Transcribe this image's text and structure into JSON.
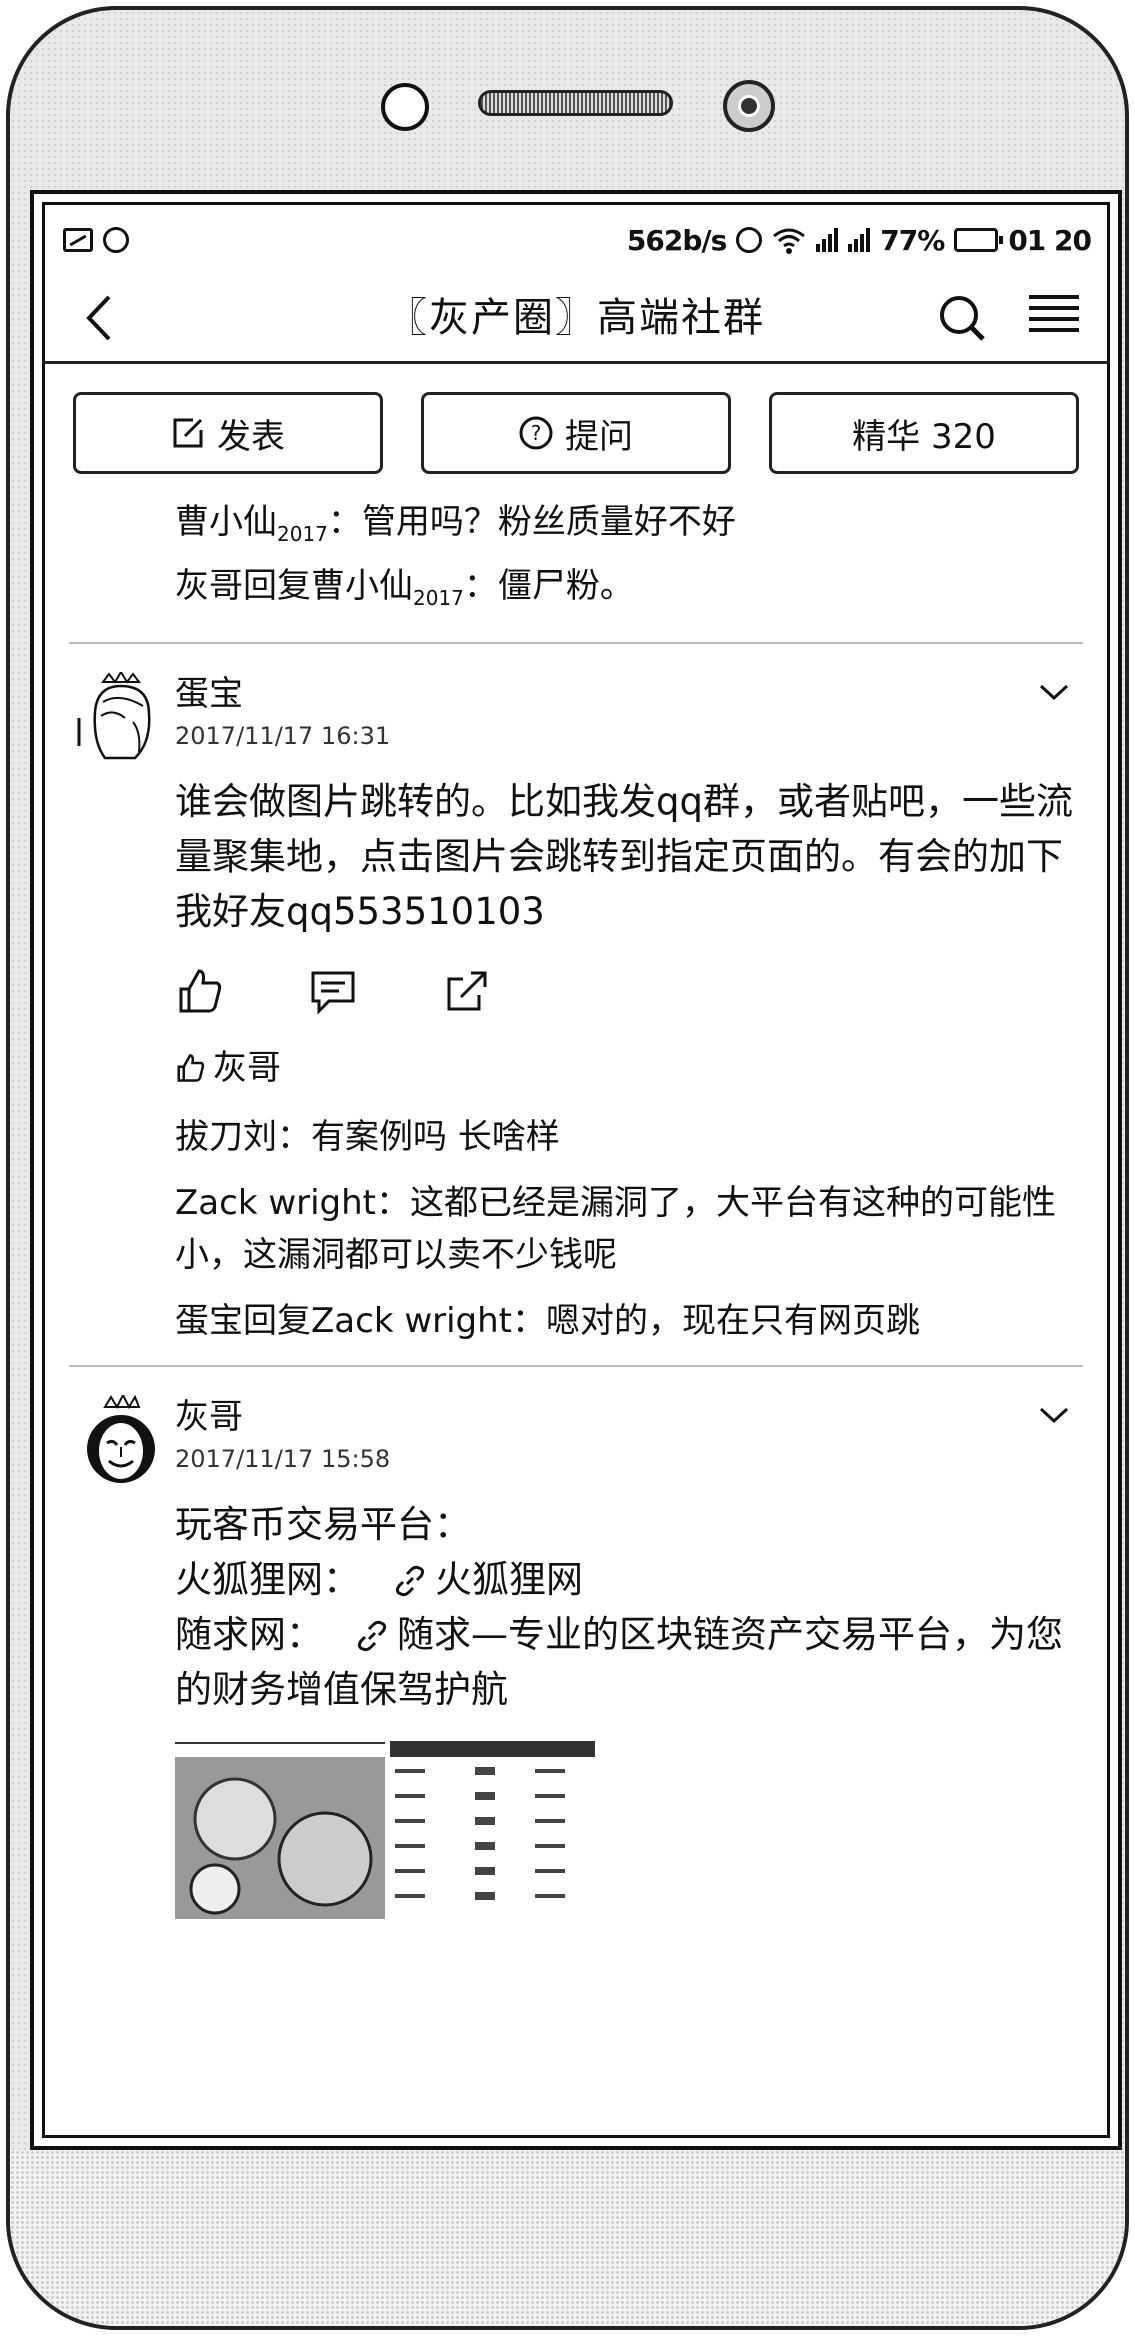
{
  "status_bar": {
    "speed": "562b/s",
    "battery": "77%",
    "time": "01 20"
  },
  "nav": {
    "title": "〖灰产圈〗高端社群"
  },
  "actions": {
    "post": "发表",
    "ask": "提问",
    "featured": "精华 320"
  },
  "top_comments": [
    {
      "author": "曹小仙",
      "author_sub": "2017",
      "text": "：管用吗？粉丝质量好不好"
    },
    {
      "author": "灰哥回复曹小仙",
      "author_sub": "2017",
      "text": "：僵尸粉。"
    }
  ],
  "post1": {
    "name": "蛋宝",
    "time": "2017/11/17 16:31",
    "body": "谁会做图片跳转的。比如我发qq群，或者贴吧，一些流量聚集地，点击图片会跳转到指定页面的。有会的加下我好友qq553510103",
    "liked_by": "灰哥",
    "comments": [
      "拔刀刘：有案例吗  长啥样",
      "Zack  wright：这都已经是漏洞了，大平台有这种的可能性小，这漏洞都可以卖不少钱呢",
      "蛋宝回复Zack  wright：嗯对的，现在只有网页跳"
    ]
  },
  "post2": {
    "name": "灰哥",
    "time": "2017/11/17 15:58",
    "line1": "玩客币交易平台：",
    "link1_label": "火狐狸网：",
    "link1_text": "火狐狸网",
    "link2_label": "随求网：",
    "link2_text": "随求—专业的区块链资产交易平台，为您的财务增值保驾护航"
  }
}
